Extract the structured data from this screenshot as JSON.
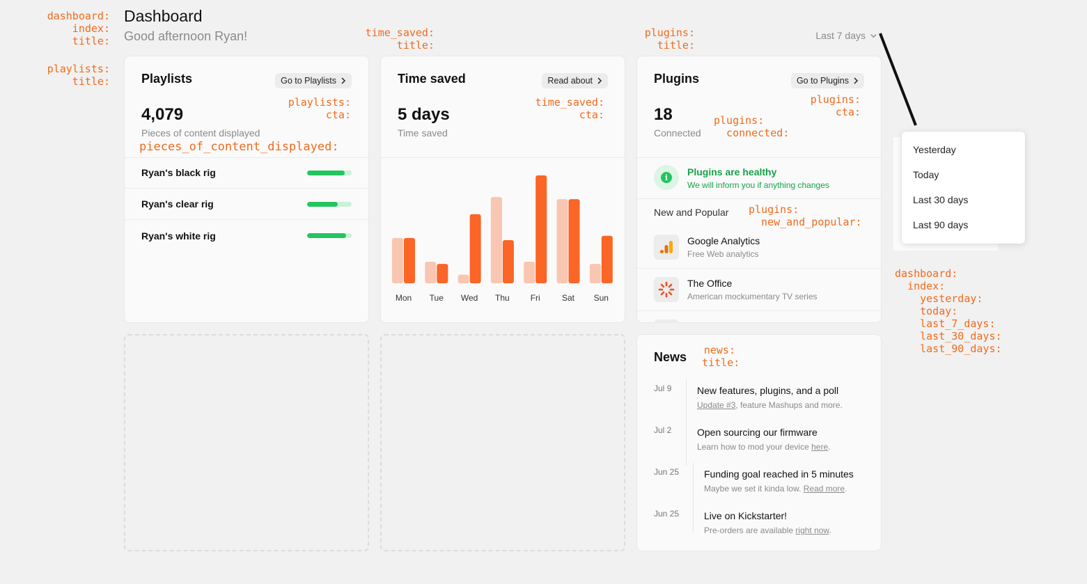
{
  "header": {
    "title": "Dashboard",
    "greeting": "Good afternoon Ryan!",
    "range_label": "Last 7 days"
  },
  "annotations": {
    "dashboard_index_title": "dashboard:\n  index:\n  title:",
    "time_saved_title": "time_saved:\n  title:",
    "plugins_title": "plugins:\n  title:",
    "playlists_title": "playlists:\n  title:",
    "playlists_cta": "playlists:\n  cta:",
    "pieces_of_content": "pieces_of_content_displayed:",
    "time_saved_cta": "time_saved:\n  cta:",
    "plugins_cta": "plugins:\n  cta:",
    "plugins_connected": "plugins:\n  connected:",
    "plugins_new_and_popular": "plugins:\n  new_and_popular:",
    "news_title": "news:\n  title:",
    "dashboard_index_ranges": "dashboard:\n  index:\n    yesterday:\n    today:\n    last_7_days:\n    last_30_days:\n    last_90_days:"
  },
  "playlists": {
    "title": "Playlists",
    "cta": "Go to Playlists",
    "count": "4,079",
    "caption": "Pieces of content displayed",
    "rigs": [
      {
        "name": "Ryan's black rig",
        "fill": 0.84
      },
      {
        "name": "Ryan's clear rig",
        "fill": 0.68
      },
      {
        "name": "Ryan's white rig",
        "fill": 0.88
      }
    ]
  },
  "time_saved": {
    "title": "Time saved",
    "cta": "Read about",
    "value": "5 days",
    "caption": "Time saved"
  },
  "chart_data": {
    "type": "bar",
    "categories": [
      "Mon",
      "Tue",
      "Wed",
      "Thu",
      "Fri",
      "Sat",
      "Sun"
    ],
    "series": [
      {
        "values": [
          42,
          20,
          8,
          80,
          20,
          78,
          18
        ],
        "color": "#f9c6b1"
      },
      {
        "values": [
          42,
          18,
          64,
          40,
          100,
          78,
          44
        ],
        "color": "#fb6526"
      }
    ],
    "ylim": [
      0,
      100
    ],
    "grid": false,
    "xlabel": "",
    "ylabel": ""
  },
  "plugins": {
    "title": "Plugins",
    "cta": "Go to Plugins",
    "count": "18",
    "caption": "Connected",
    "healthy_title": "Plugins are healthy",
    "healthy_sub": "We will inform you if anything changes",
    "new_and_popular": "New and Popular",
    "items": [
      {
        "name": "Google Analytics",
        "desc": "Free Web analytics",
        "icon": "google-analytics-icon"
      },
      {
        "name": "The Office",
        "desc": "American mockumentary TV series",
        "icon": "the-office-icon"
      }
    ]
  },
  "news": {
    "title": "News",
    "items": [
      {
        "date": "Jul 9",
        "title": "New features, plugins, and a poll",
        "link": "Update #3",
        "after": ", feature Mashups and more."
      },
      {
        "date": "Jul 2",
        "title": "Open sourcing our firmware",
        "before": "Learn how to mod your device ",
        "link": "here",
        "after": "."
      },
      {
        "date": "Jun 25",
        "title": "Funding goal reached in 5 minutes",
        "before": "Maybe we set it kinda low. ",
        "link": "Read more",
        "after": "."
      },
      {
        "date": "Jun 25",
        "title": "Live on Kickstarter!",
        "before": "Pre-orders are available ",
        "link": "right now",
        "after": "."
      }
    ]
  },
  "range_menu": {
    "options": [
      "Yesterday",
      "Today",
      "Last 30 days",
      "Last 90 days"
    ]
  },
  "colors": {
    "accent": "#fb6526",
    "accent_light": "#f9c6b1",
    "success": "#22c55e",
    "annotation": "#f26a1b"
  }
}
